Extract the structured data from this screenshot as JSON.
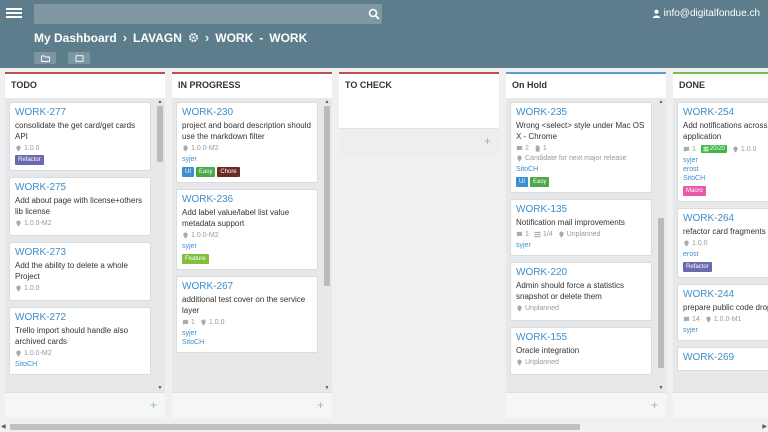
{
  "header": {
    "search": {
      "placeholder": ""
    },
    "user_email": "info@digitalfondue.ch",
    "breadcrumb": {
      "dashboard": "My Dashboard",
      "project": "LAVAGN",
      "board_part1": "WORK",
      "board_sep": "-",
      "board_part2": "WORK"
    },
    "icons": [
      "menu-icon",
      "search-icon",
      "user-icon",
      "gear-icon",
      "folder-icon",
      "window-icon"
    ]
  },
  "columns": {
    "todo": {
      "title": "TODO",
      "cards": [
        {
          "id": "WORK-277",
          "title": "consolidate the get card/get cards API",
          "milestone": "1.0.0",
          "labels": [
            "Refactor"
          ]
        },
        {
          "id": "WORK-275",
          "title": "Add about page with license+others lib license",
          "milestone": "1.0.0-M2"
        },
        {
          "id": "WORK-273",
          "title": "Add the ability to delete a whole Project",
          "milestone": "1.0.0"
        },
        {
          "id": "WORK-272",
          "title": "Trello import should handle also archived cards",
          "milestone": "1.0.0-M2",
          "user": "SitoCH"
        }
      ]
    },
    "progress": {
      "title": "IN PROGRESS",
      "cards": [
        {
          "id": "WORK-230",
          "title": "project and board description should use the markdown filter",
          "milestone": "1.0.0-M2",
          "user": "syjer",
          "labels": [
            "UI",
            "Easy",
            "Chore"
          ]
        },
        {
          "id": "WORK-236",
          "title": "Add label value/label list value metadata support",
          "milestone": "1.0.0-M2",
          "user": "syjer",
          "labels": [
            "Feature"
          ]
        },
        {
          "id": "WORK-267",
          "title": "additional test cover on the service layer",
          "comments": "1",
          "milestone": "1.0.0",
          "users": [
            "syjer",
            "SitoCH"
          ]
        }
      ]
    },
    "check": {
      "title": "TO CHECK"
    },
    "hold": {
      "title": "On Hold",
      "cards": [
        {
          "id": "WORK-235",
          "title": "Wrong <select> style under Mac OS X - Chrome",
          "comments": "2",
          "files": "1",
          "milestone": "Candidate for next major release",
          "user": "SitoCH",
          "labels": [
            "UI",
            "Easy"
          ]
        },
        {
          "id": "WORK-135",
          "title": "Notification mail improvements",
          "comments": "1",
          "checklist": "1/4",
          "milestone": "Unplanned",
          "user": "syjer"
        },
        {
          "id": "WORK-220",
          "title": "Admin should force a statistics snapshot or delete them",
          "milestone": "Unplanned"
        },
        {
          "id": "WORK-155",
          "title": "Oracle integration",
          "milestone": "Unplanned"
        }
      ]
    },
    "done": {
      "title": "DONE",
      "cards": [
        {
          "id": "WORK-254",
          "title": "Add notifications across application",
          "comments": "1",
          "checklist": "20/20",
          "milestone": "1.0.0",
          "users": [
            "syjer",
            "erost",
            "SitoCH"
          ],
          "labels": [
            "Macro"
          ]
        },
        {
          "id": "WORK-264",
          "title": "refactor card fragments",
          "milestone": "1.0.0",
          "user": "erost",
          "labels": [
            "Refactor"
          ]
        },
        {
          "id": "WORK-244",
          "title": "prepare public code drop",
          "comments": "14",
          "milestone": "1.0.0-M1",
          "user": "syjer"
        },
        {
          "id": "WORK-269"
        }
      ]
    }
  },
  "footer": {
    "add_symbol": "+"
  }
}
